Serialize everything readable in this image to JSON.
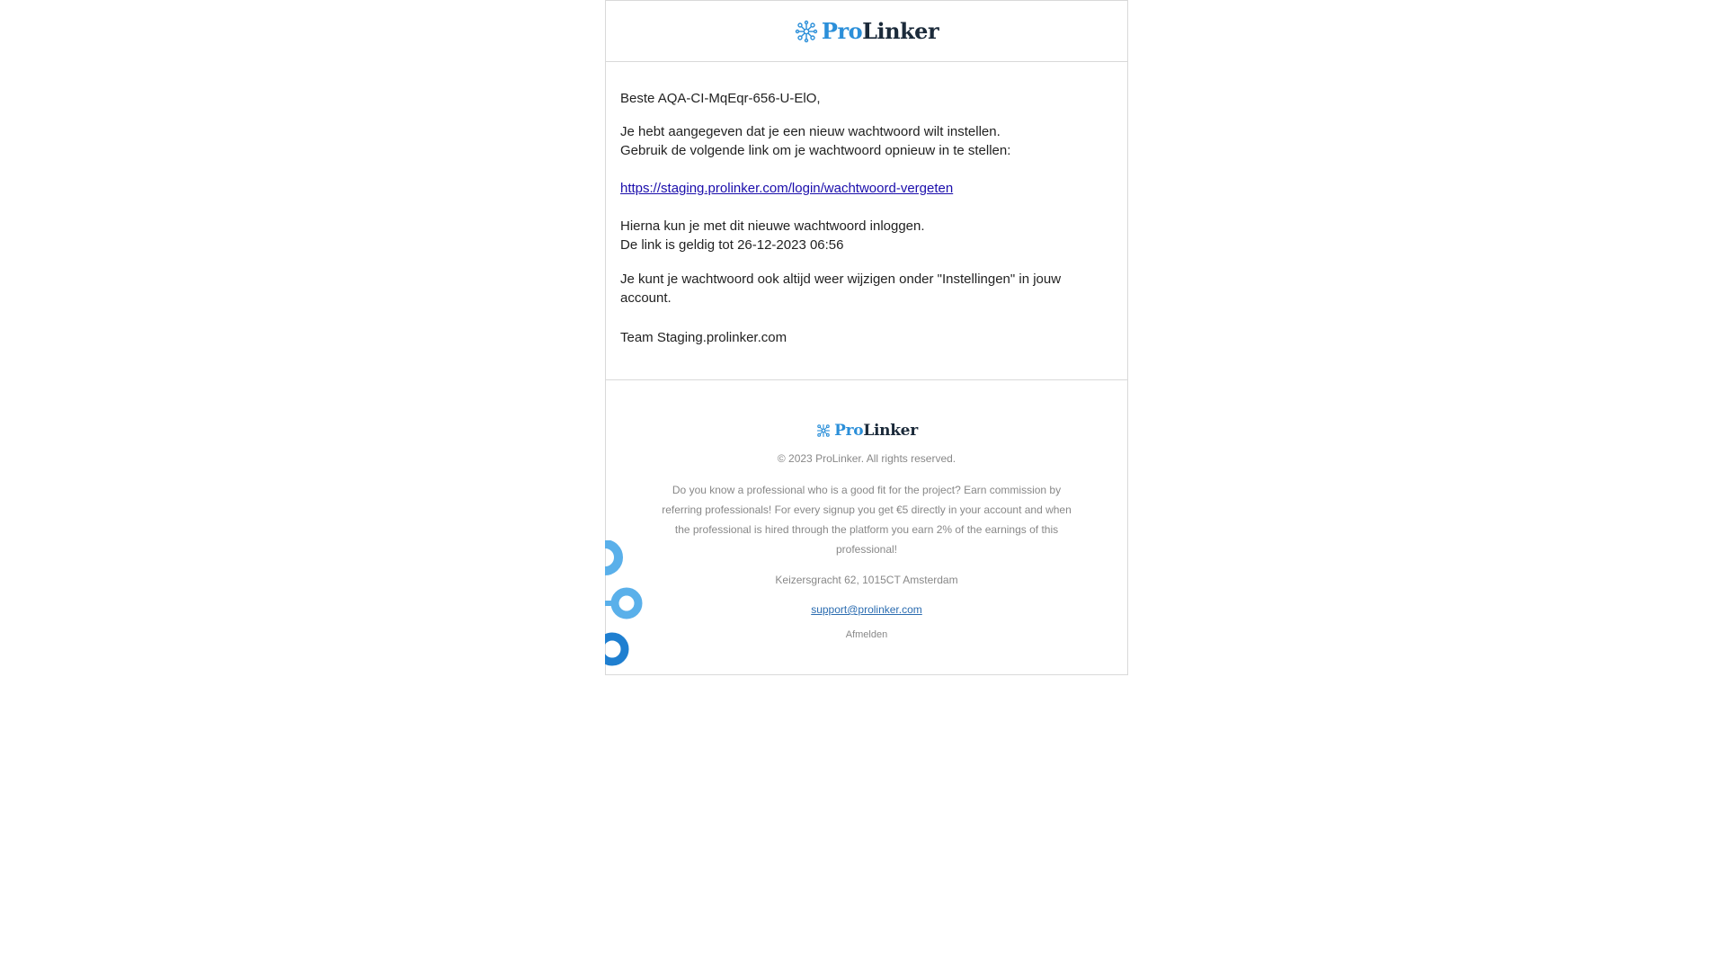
{
  "header": {
    "logo_pro": "Pro",
    "logo_linker": "Linker"
  },
  "message": {
    "greeting": "Beste AQA-CI-MqEqr-656-U-ElO,",
    "line1": "Je hebt aangegeven dat je een nieuw wachtwoord wilt instellen.",
    "line2": "Gebruik de volgende link om je wachtwoord opnieuw in te stellen:",
    "reset_link": "https://staging.prolinker.com/login/wachtwoord-vergeten",
    "line3": "Hierna kun je met dit nieuwe wachtwoord inloggen.",
    "line4": "De link is geldig tot 26-12-2023 06:56",
    "line5": "Je kunt je wachtwoord ook altijd weer wijzigen onder \"Instellingen\" in jouw account.",
    "signature": "Team Staging.prolinker.com"
  },
  "footer": {
    "logo_pro": "Pro",
    "logo_linker": "Linker",
    "copyright": "© 2023 ProLinker. All rights reserved.",
    "referral": "Do you know a professional who is a good fit for the project? Earn commission by referring professionals! For every signup you get €5 directly in your account and when the professional is hired through the platform you earn 2% of the earnings of this professional!",
    "address": "Keizersgracht 62, 1015CT Amsterdam",
    "support_email": "support@prolinker.com",
    "unsubscribe": "Afmelden"
  },
  "colors": {
    "brand_blue": "#2b8fd9",
    "brand_dark": "#1b2a3a",
    "link": "#1a0dab",
    "muted_text": "#888888",
    "border": "#d9d9d9"
  },
  "icons": {
    "logo_mark": "network-nodes-icon",
    "decoration": "blue-rings-decoration"
  }
}
